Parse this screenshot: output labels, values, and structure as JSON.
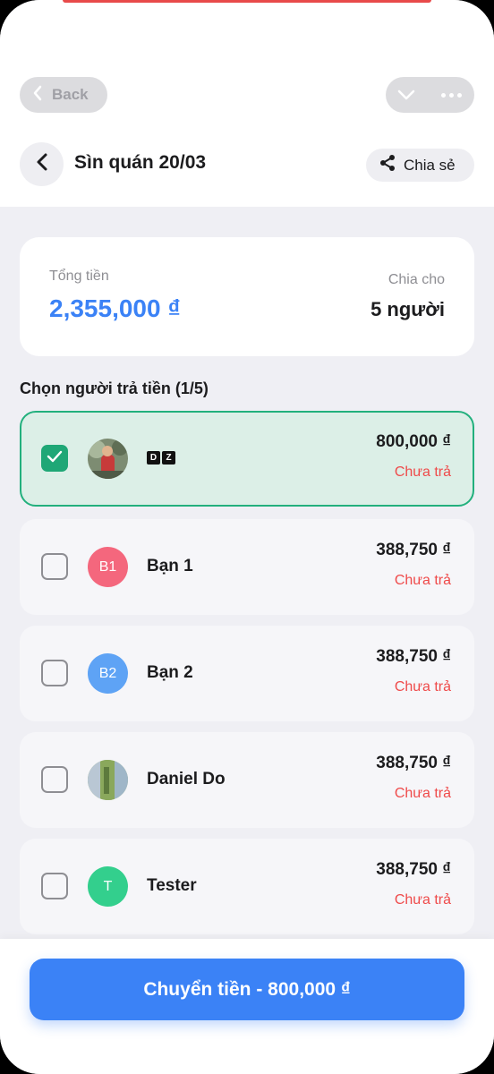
{
  "topbar": {
    "back_label": "Back"
  },
  "header": {
    "title": "Sìn quán 20/03",
    "share_label": "Chia sẻ"
  },
  "summary": {
    "total_label": "Tổng tiền",
    "total_value": "2,355,000 ₫",
    "split_label": "Chia cho",
    "split_value": "5 người"
  },
  "payer_section": {
    "title": "Chọn người trả tiền (1/5)"
  },
  "people": [
    {
      "name_badge": [
        "D",
        "Z"
      ],
      "amount": "800,000 ₫",
      "status": "Chưa trả",
      "selected": true,
      "avatar": "photo"
    },
    {
      "name": "Bạn 1",
      "initials": "B1",
      "amount": "388,750 ₫",
      "status": "Chưa trả",
      "selected": false,
      "avatar_color": "#f4677d"
    },
    {
      "name": "Bạn 2",
      "initials": "B2",
      "amount": "388,750 ₫",
      "status": "Chưa trả",
      "selected": false,
      "avatar_color": "#5ea3f5"
    },
    {
      "name": "Daniel Do",
      "amount": "388,750 ₫",
      "status": "Chưa trả",
      "selected": false,
      "avatar": "photo"
    },
    {
      "name": "Tester",
      "initials": "T",
      "amount": "388,750 ₫",
      "status": "Chưa trả",
      "selected": false,
      "avatar_color": "#33cf8d"
    }
  ],
  "footer": {
    "pay_button_label": "Chuyển tiền - 800,000 ₫"
  },
  "colors": {
    "accent": "#3b82f6",
    "selected_border": "#22b07d",
    "unpaid": "#ef4a4a"
  }
}
